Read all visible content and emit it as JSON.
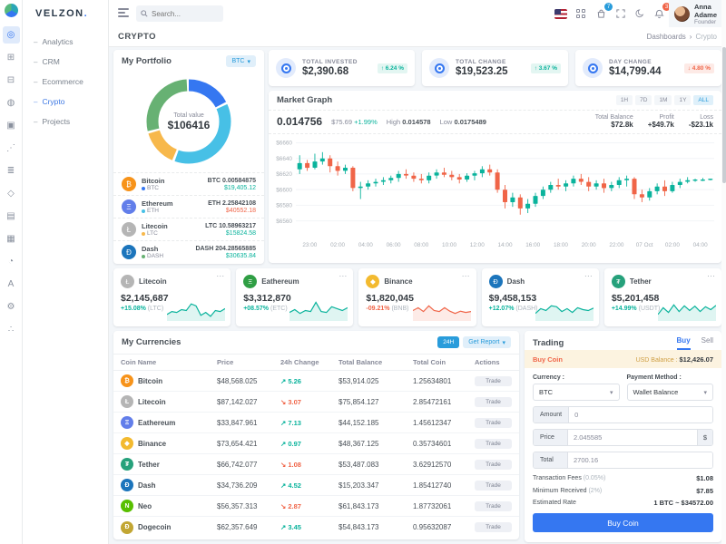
{
  "ui": {
    "chevron": "▾",
    "menu_dots": "⋯",
    "crumb_sep": "›"
  },
  "brand": {
    "name": "VELZON"
  },
  "header": {
    "search_placeholder": "Search...",
    "cart_badge": "7",
    "notif_badge": "3",
    "user": {
      "name": "Anna Adame",
      "role": "Founder"
    }
  },
  "breadcrumb": {
    "title": "CRYPTO",
    "root": "Dashboards",
    "current": "Crypto"
  },
  "sidebar": {
    "rail": [
      {
        "name": "rail-dashboards-icon",
        "glyph": "◎",
        "active": true
      },
      {
        "name": "rail-apps-icon",
        "glyph": "⊞",
        "active": false
      },
      {
        "name": "rail-layouts-icon",
        "glyph": "⊟",
        "active": false
      },
      {
        "name": "rail-authentication-icon",
        "glyph": "◍",
        "active": false
      },
      {
        "name": "rail-pages-icon",
        "glyph": "▣",
        "active": false
      },
      {
        "name": "rail-forms-icon",
        "glyph": "⋰",
        "active": false
      },
      {
        "name": "rail-components-icon",
        "glyph": "≣",
        "active": false
      },
      {
        "name": "rail-security-icon",
        "glyph": "◇",
        "active": false
      },
      {
        "name": "rail-invoices-icon",
        "glyph": "▤",
        "active": false
      },
      {
        "name": "rail-tables-icon",
        "glyph": "▦",
        "active": false
      },
      {
        "name": "rail-charts-icon",
        "glyph": "◔",
        "active": false
      },
      {
        "name": "rail-alphabet-icon",
        "glyph": "A",
        "active": false
      },
      {
        "name": "rail-settings-icon",
        "glyph": "⚙",
        "active": false
      },
      {
        "name": "rail-share-icon",
        "glyph": "∴",
        "active": false
      }
    ],
    "items": [
      {
        "label": "Analytics",
        "active": false
      },
      {
        "label": "CRM",
        "active": false
      },
      {
        "label": "Ecommerce",
        "active": false
      },
      {
        "label": "Crypto",
        "active": true
      },
      {
        "label": "Projects",
        "active": false
      }
    ]
  },
  "portfolio": {
    "title": "My Portfolio",
    "currency_selector": "BTC",
    "total_label": "Total value",
    "total_value": "$106416",
    "coins": [
      {
        "name": "Bitcoin",
        "symbol": "BTC",
        "glyph": "₿",
        "icon_color": "#f7931a",
        "seg_color": "#3577f1",
        "amount": "BTC 0.00584875",
        "usd": "$19,405.12",
        "positive": true
      },
      {
        "name": "Ethereum",
        "symbol": "ETH",
        "glyph": "Ξ",
        "icon_color": "#627eea",
        "seg_color": "#47c0e6",
        "amount": "ETH 2.25842108",
        "usd": "$40552.18",
        "positive": false
      },
      {
        "name": "Litecoin",
        "symbol": "LTC",
        "glyph": "Ł",
        "icon_color": "#b5b5b5",
        "seg_color": "#f7b84b",
        "amount": "LTC 10.58963217",
        "usd": "$15824.58",
        "positive": true
      },
      {
        "name": "Dash",
        "symbol": "DASH",
        "glyph": "Đ",
        "icon_color": "#1c75bc",
        "seg_color": "#67b173",
        "amount": "DASH 204.28565885",
        "usd": "$30635.84",
        "positive": true
      }
    ],
    "values_num": [
      19405.12,
      40552.18,
      15824.58,
      30635.84
    ]
  },
  "stats": [
    {
      "label": "TOTAL INVESTED",
      "value": "$2,390.68",
      "change": "6.24 %",
      "dir": "up"
    },
    {
      "label": "TOTAL CHANGE",
      "value": "$19,523.25",
      "change": "3.67 %",
      "dir": "up"
    },
    {
      "label": "DAY CHANGE",
      "value": "$14,799.44",
      "change": "4.80 %",
      "dir": "down"
    }
  ],
  "market": {
    "title": "Market Graph",
    "ranges": [
      "1H",
      "7D",
      "1M",
      "1Y",
      "ALL"
    ],
    "active_range": "ALL",
    "price": "0.014756",
    "usd": "$75.69",
    "change": "+1.99%",
    "high_label": "High",
    "high": "0.014578",
    "low_label": "Low",
    "low": "0.0175489",
    "balance_label": "Total Balance",
    "balance": "$72.8k",
    "profit_label": "Profit",
    "profit": "+$49.7k",
    "loss_label": "Loss",
    "loss": "-$23.1k"
  },
  "chart_data": {
    "type": "candlestick",
    "title": "Market Graph",
    "x_labels": [
      "23:00",
      "02:00",
      "04:00",
      "06:00",
      "08:00",
      "10:00",
      "12:00",
      "14:00",
      "16:00",
      "18:00",
      "20:00",
      "22:00",
      "07 Oct",
      "02:00",
      "04:00"
    ],
    "y_ticks": [
      6660,
      6640,
      6620,
      6600,
      6580,
      6560
    ],
    "y_prefix": "$",
    "ylim": [
      6548,
      6664
    ],
    "up_color": "#0ab39c",
    "down_color": "#f06548",
    "grid": true,
    "candles": [
      [
        6626,
        6644,
        6620,
        6634
      ],
      [
        6634,
        6638,
        6624,
        6628
      ],
      [
        6628,
        6646,
        6626,
        6636
      ],
      [
        6636,
        6648,
        6632,
        6640
      ],
      [
        6640,
        6644,
        6622,
        6630
      ],
      [
        6630,
        6636,
        6618,
        6624
      ],
      [
        6624,
        6632,
        6620,
        6628
      ],
      [
        6628,
        6630,
        6598,
        6602
      ],
      [
        6602,
        6610,
        6588,
        6604
      ],
      [
        6604,
        6612,
        6600,
        6608
      ],
      [
        6608,
        6614,
        6604,
        6610
      ],
      [
        6610,
        6616,
        6606,
        6612
      ],
      [
        6612,
        6618,
        6608,
        6615
      ],
      [
        6615,
        6624,
        6610,
        6620
      ],
      [
        6620,
        6626,
        6614,
        6618
      ],
      [
        6618,
        6622,
        6610,
        6614
      ],
      [
        6614,
        6620,
        6608,
        6612
      ],
      [
        6612,
        6622,
        6608,
        6618
      ],
      [
        6618,
        6626,
        6614,
        6622
      ],
      [
        6622,
        6628,
        6616,
        6619
      ],
      [
        6619,
        6624,
        6612,
        6616
      ],
      [
        6616,
        6620,
        6608,
        6613
      ],
      [
        6613,
        6621,
        6610,
        6618
      ],
      [
        6618,
        6624,
        6612,
        6621
      ],
      [
        6621,
        6630,
        6616,
        6626
      ],
      [
        6626,
        6632,
        6618,
        6622
      ],
      [
        6622,
        6626,
        6596,
        6600
      ],
      [
        6600,
        6606,
        6576,
        6584
      ],
      [
        6584,
        6596,
        6578,
        6590
      ],
      [
        6590,
        6594,
        6568,
        6576
      ],
      [
        6576,
        6588,
        6570,
        6582
      ],
      [
        6582,
        6596,
        6578,
        6592
      ],
      [
        6592,
        6604,
        6588,
        6600
      ],
      [
        6600,
        6610,
        6596,
        6606
      ],
      [
        6606,
        6614,
        6600,
        6604
      ],
      [
        6604,
        6612,
        6598,
        6608
      ],
      [
        6608,
        6618,
        6604,
        6614
      ],
      [
        6614,
        6620,
        6606,
        6610
      ],
      [
        6610,
        6616,
        6598,
        6604
      ],
      [
        6604,
        6612,
        6600,
        6608
      ],
      [
        6608,
        6614,
        6596,
        6602
      ],
      [
        6602,
        6610,
        6598,
        6606
      ],
      [
        6606,
        6616,
        6602,
        6612
      ],
      [
        6612,
        6618,
        6604,
        6614
      ],
      [
        6614,
        6616,
        6588,
        6594
      ],
      [
        6594,
        6600,
        6584,
        6590
      ],
      [
        6590,
        6602,
        6586,
        6598
      ],
      [
        6598,
        6608,
        6594,
        6604
      ],
      [
        6604,
        6612,
        6592,
        6598
      ],
      [
        6598,
        6610,
        6596,
        6606
      ],
      [
        6606,
        6614,
        6602,
        6610
      ],
      [
        6610,
        6616,
        6608,
        6612
      ],
      [
        6612,
        6614,
        6610,
        6613
      ],
      [
        6613,
        6615,
        6611,
        6613
      ],
      [
        6613,
        6614,
        6612,
        6614
      ]
    ]
  },
  "watchlist": [
    {
      "name": "Litecoin",
      "glyph": "Ł",
      "icon_color": "#b5b5b5",
      "value": "$2,145,687",
      "change": "+15.08%",
      "pair": "(LTC)",
      "positive": true,
      "spark": [
        25,
        40,
        35,
        50,
        45,
        80,
        70,
        20,
        35,
        15,
        45,
        40,
        55
      ]
    },
    {
      "name": "Eathereum",
      "glyph": "Ξ",
      "icon_color": "#2f9e44",
      "value": "$3,312,870",
      "change": "+08.57%",
      "pair": "(ETC)",
      "positive": true,
      "spark": [
        35,
        50,
        30,
        45,
        40,
        88,
        40,
        35,
        65,
        55,
        45,
        60
      ]
    },
    {
      "name": "Binance",
      "glyph": "◆",
      "icon_color": "#f3ba2f",
      "value": "$1,820,045",
      "change": "-09.21%",
      "pair": "(BNB)",
      "positive": false,
      "spark": [
        45,
        60,
        40,
        70,
        45,
        40,
        60,
        42,
        30,
        42,
        35,
        40
      ]
    },
    {
      "name": "Dash",
      "glyph": "Đ",
      "icon_color": "#1c75bc",
      "value": "$9,458,153",
      "change": "+12.07%",
      "pair": "(DASH)",
      "positive": true,
      "spark": [
        30,
        55,
        45,
        70,
        65,
        40,
        55,
        35,
        60,
        50,
        45,
        58
      ]
    },
    {
      "name": "Tether",
      "glyph": "₮",
      "icon_color": "#26a17b",
      "value": "$5,201,458",
      "change": "+14.99%",
      "pair": "(USDT)",
      "positive": true,
      "spark": [
        25,
        60,
        35,
        75,
        40,
        70,
        45,
        68,
        40,
        65,
        50,
        72
      ]
    }
  ],
  "currencies": {
    "title": "My Currencies",
    "button_24h": "24H",
    "button_report": "Get Report",
    "columns": [
      "Coin Name",
      "Price",
      "24h Change",
      "Total Balance",
      "Total Coin",
      "Actions"
    ],
    "trade_label": "Trade",
    "rows": [
      {
        "name": "Bitcoin",
        "glyph": "₿",
        "icon_color": "#f7931a",
        "price": "$48,568.025",
        "change": "5.26",
        "dir": "up",
        "balance": "$53,914.025",
        "coin": "1.25634801"
      },
      {
        "name": "Litecoin",
        "glyph": "Ł",
        "icon_color": "#b5b5b5",
        "price": "$87,142.027",
        "change": "3.07",
        "dir": "down",
        "balance": "$75,854.127",
        "coin": "2.85472161"
      },
      {
        "name": "Eathereum",
        "glyph": "Ξ",
        "icon_color": "#627eea",
        "price": "$33,847.961",
        "change": "7.13",
        "dir": "up",
        "balance": "$44,152.185",
        "coin": "1.45612347"
      },
      {
        "name": "Binance",
        "glyph": "◆",
        "icon_color": "#f3ba2f",
        "price": "$73,654.421",
        "change": "0.97",
        "dir": "up",
        "balance": "$48,367.125",
        "coin": "0.35734601"
      },
      {
        "name": "Tether",
        "glyph": "₮",
        "icon_color": "#26a17b",
        "price": "$66,742.077",
        "change": "1.08",
        "dir": "down",
        "balance": "$53,487.083",
        "coin": "3.62912570"
      },
      {
        "name": "Dash",
        "glyph": "Đ",
        "icon_color": "#1c75bc",
        "price": "$34,736.209",
        "change": "4.52",
        "dir": "up",
        "balance": "$15,203.347",
        "coin": "1.85412740"
      },
      {
        "name": "Neo",
        "glyph": "N",
        "icon_color": "#58bf00",
        "price": "$56,357.313",
        "change": "2.87",
        "dir": "down",
        "balance": "$61,843.173",
        "coin": "1.87732061"
      },
      {
        "name": "Dogecoin",
        "glyph": "Ð",
        "icon_color": "#c2a633",
        "price": "$62,357.649",
        "change": "3.45",
        "dir": "up",
        "balance": "$54,843.173",
        "coin": "0.95632087"
      }
    ]
  },
  "trading": {
    "title": "Trading",
    "tab_buy": "Buy",
    "tab_sell": "Sell",
    "banner_left": "Buy Coin",
    "balance_label": "USD Balance :",
    "balance_value": "$12,426.07",
    "currency_label": "Currency :",
    "currency_value": "BTC",
    "payment_label": "Payment Method :",
    "payment_value": "Wallet Balance",
    "amount_label": "Amount",
    "amount_value": "0",
    "price_label": "Price",
    "price_value": "2.045585",
    "price_suffix": "$",
    "total_label": "Total",
    "total_value": "2700.16",
    "fees": [
      {
        "label": "Transaction Fees",
        "sub": "(0.05%)",
        "value": "$1.08"
      },
      {
        "label": "Minimum Received",
        "sub": "(2%)",
        "value": "$7.85"
      },
      {
        "label": "Estimated Rate",
        "sub": "",
        "value": "1 BTC ~ $34572.00"
      }
    ],
    "buy_button": "Buy Coin"
  }
}
